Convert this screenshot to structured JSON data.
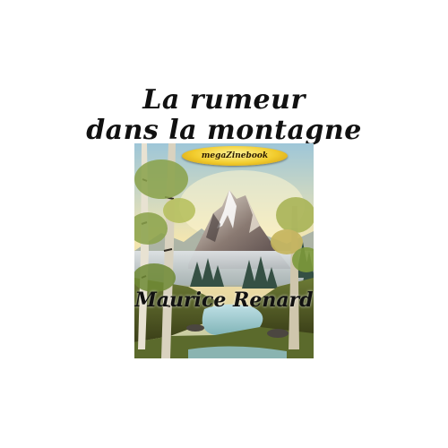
{
  "book": {
    "title_line_1": "La rumeur",
    "title_line_2": "dans la montagne",
    "publisher_badge": "megaZinebook",
    "author": "Maurice Renard"
  },
  "colors": {
    "background": "#ffffff",
    "title_text": "#111111",
    "badge_gold": "#f2cc2d"
  },
  "illustration": {
    "subject": "painted mountain landscape with birch trees and a river"
  }
}
